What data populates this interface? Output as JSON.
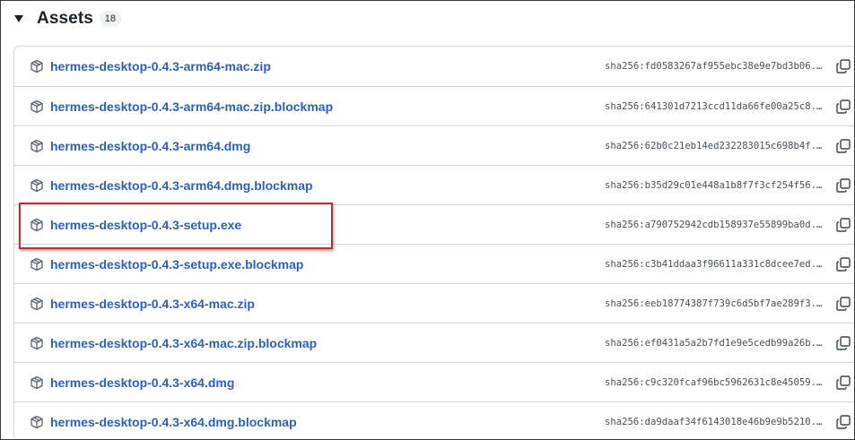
{
  "assets": {
    "title": "Assets",
    "count": "18",
    "toggle_icon": "triangle-down-icon",
    "row_icon": "package-icon",
    "copy_icon": "copy-icon",
    "link_color": "#2f5fb9",
    "highlight_color": "#c42b2b",
    "highlighted_item": "hermes-desktop-0.4.3-setup.exe",
    "items": [
      {
        "name": "hermes-desktop-0.4.3-arm64-mac.zip",
        "sha": "sha256:fd0583267af955ebc38e9e7bd3b06..."
      },
      {
        "name": "hermes-desktop-0.4.3-arm64-mac.zip.blockmap",
        "sha": "sha256:641301d7213ccd11da66fe00a25c8..."
      },
      {
        "name": "hermes-desktop-0.4.3-arm64.dmg",
        "sha": "sha256:62b0c21eb14ed232283015c698b4f..."
      },
      {
        "name": "hermes-desktop-0.4.3-arm64.dmg.blockmap",
        "sha": "sha256:b35d29c01e448a1b8f7f3cf254f56..."
      },
      {
        "name": "hermes-desktop-0.4.3-setup.exe",
        "sha": "sha256:a790752942cdb158937e55899ba0d..."
      },
      {
        "name": "hermes-desktop-0.4.3-setup.exe.blockmap",
        "sha": "sha256:c3b41ddaa3f96611a331c8dcee7ed..."
      },
      {
        "name": "hermes-desktop-0.4.3-x64-mac.zip",
        "sha": "sha256:eeb18774387f739c6d5bf7ae289f3..."
      },
      {
        "name": "hermes-desktop-0.4.3-x64-mac.zip.blockmap",
        "sha": "sha256:ef0431a5a2b7fd1e9e5cedb99a26b..."
      },
      {
        "name": "hermes-desktop-0.4.3-x64.dmg",
        "sha": "sha256:c9c320fcaf96bc5962631c8e45059..."
      },
      {
        "name": "hermes-desktop-0.4.3-x64.dmg.blockmap",
        "sha": "sha256:da9daaf34f6143018e46b9e9b5210..."
      }
    ]
  }
}
